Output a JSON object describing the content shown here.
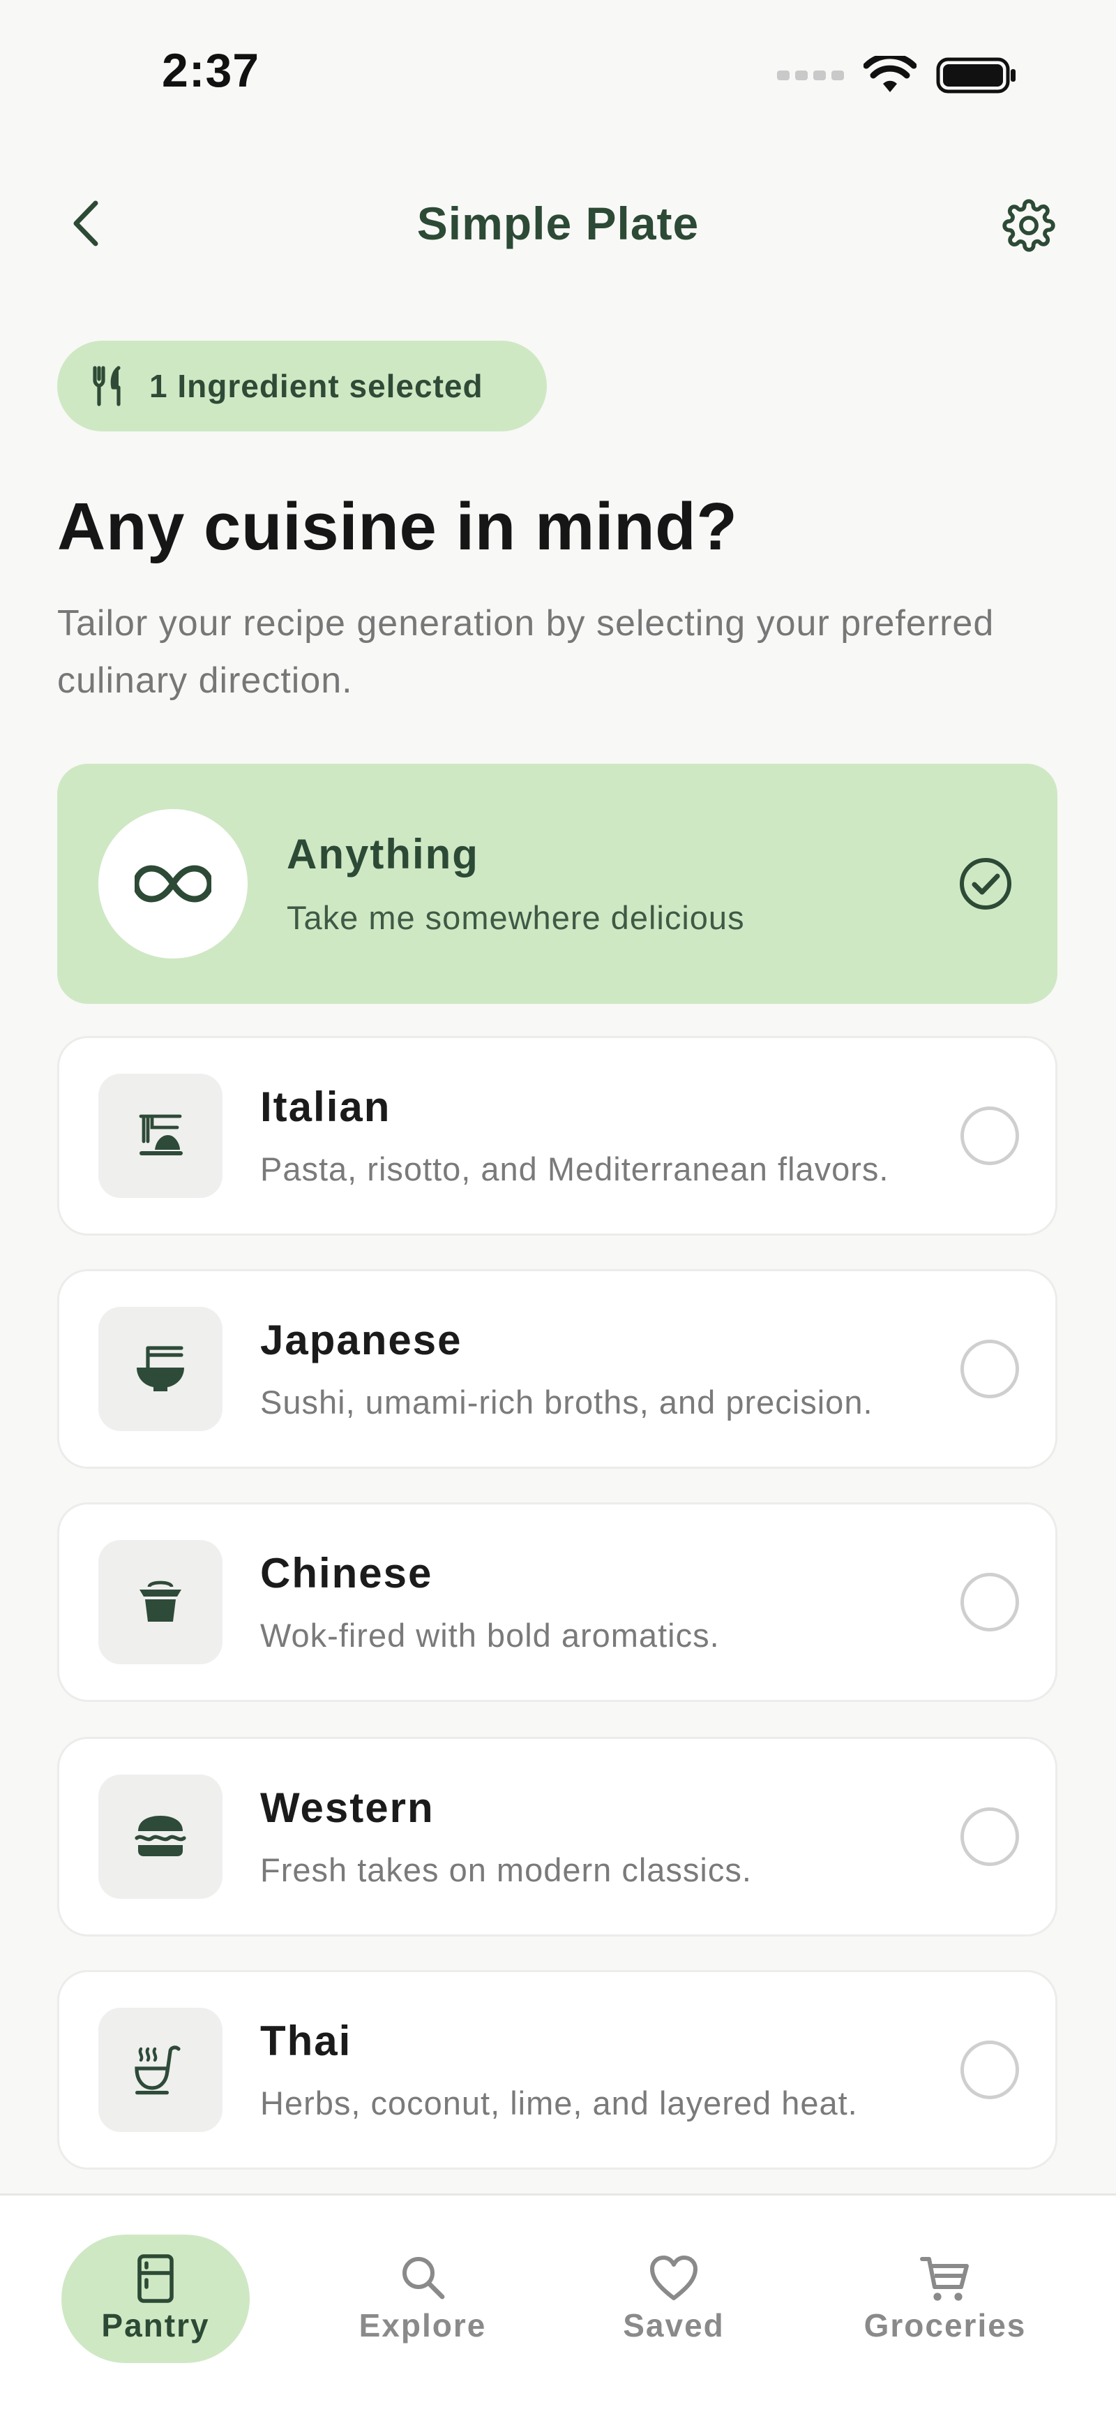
{
  "status_bar": {
    "time": "2:37"
  },
  "header": {
    "title": "Simple Plate"
  },
  "ingredient_pill": {
    "label": "1 Ingredient selected"
  },
  "headline": "Any cuisine in mind?",
  "subtext": "Tailor your recipe generation by selecting your preferred culinary direction.",
  "cuisines": [
    {
      "name": "Anything",
      "desc": "Take me somewhere delicious",
      "icon": "infinity-icon",
      "selected": true
    },
    {
      "name": "Italian",
      "desc": "Pasta, risotto, and Mediterranean flavors.",
      "icon": "pasta-icon",
      "selected": false
    },
    {
      "name": "Japanese",
      "desc": "Sushi, umami-rich broths, and precision.",
      "icon": "ramen-bowl-icon",
      "selected": false
    },
    {
      "name": "Chinese",
      "desc": "Wok-fired with bold aromatics.",
      "icon": "takeout-box-icon",
      "selected": false
    },
    {
      "name": "Western",
      "desc": "Fresh takes on modern classics.",
      "icon": "burger-icon",
      "selected": false
    },
    {
      "name": "Thai",
      "desc": "Herbs, coconut, lime, and layered heat.",
      "icon": "soup-ladle-icon",
      "selected": false
    }
  ],
  "nav": [
    {
      "label": "Pantry",
      "icon": "fridge-icon",
      "active": true
    },
    {
      "label": "Explore",
      "icon": "search-icon",
      "active": false
    },
    {
      "label": "Saved",
      "icon": "heart-icon",
      "active": false
    },
    {
      "label": "Groceries",
      "icon": "cart-icon",
      "active": false
    }
  ],
  "colors": {
    "accent": "#cfe8c4",
    "accent_dark": "#2c4a35",
    "background": "#f8f8f6"
  }
}
